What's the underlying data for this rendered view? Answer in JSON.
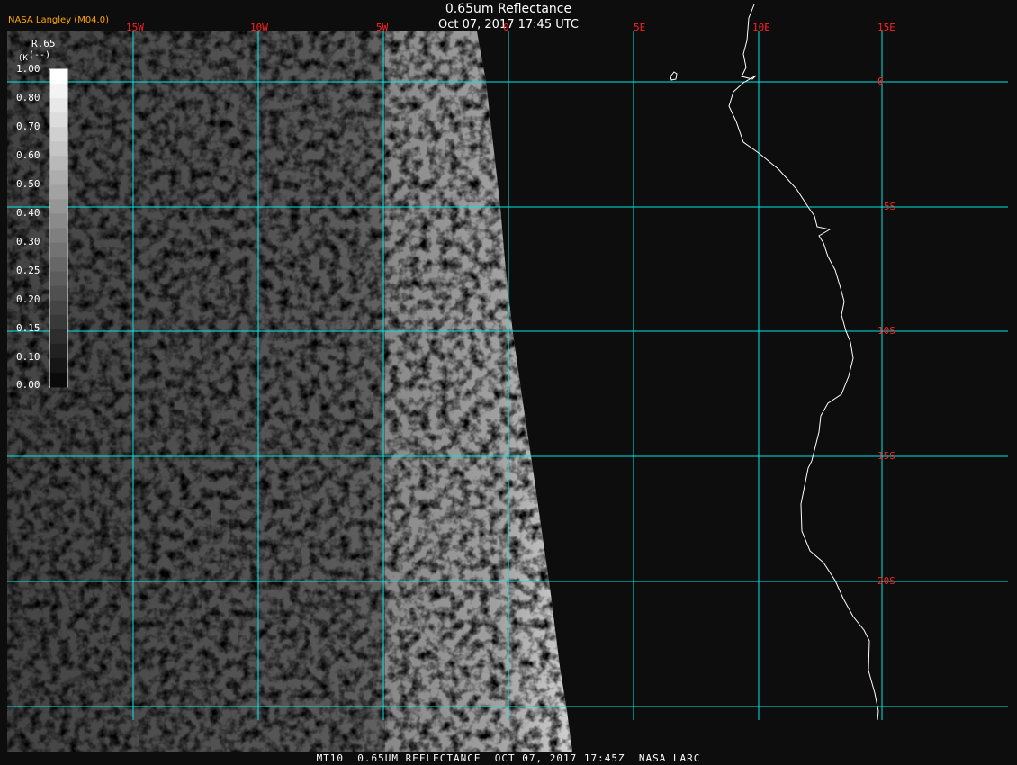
{
  "title": "0.65um Reflectance",
  "datetime": "Oct 07, 2017 17:45 UTC",
  "credit": "NASA Langley (M04.0)",
  "footer": "MT10  0.65UM REFLECTANCE  OCT 07, 2017 17:45Z  NASA LARC",
  "colorbar": {
    "title": "R.65",
    "unit": "(--)",
    "unit_prefix": "(K",
    "ticks": [
      "1.00",
      "0.80",
      "0.70",
      "0.60",
      "0.50",
      "0.40",
      "0.30",
      "0.25",
      "0.20",
      "0.15",
      "0.10",
      "0.00"
    ]
  },
  "grid": {
    "color": "#00e5e5",
    "label_color": "#ff2020",
    "longitudes": [
      "15W",
      "10W",
      "5W",
      "0",
      "5E",
      "10E",
      "15E"
    ],
    "latitudes": [
      "0",
      "5S",
      "10S",
      "15S",
      "20S"
    ]
  },
  "colors": {
    "background": "#000000",
    "land": "#0d0d0d",
    "coastline": "#ffffff",
    "title": "#ffffff",
    "credit": "#ffa500"
  }
}
